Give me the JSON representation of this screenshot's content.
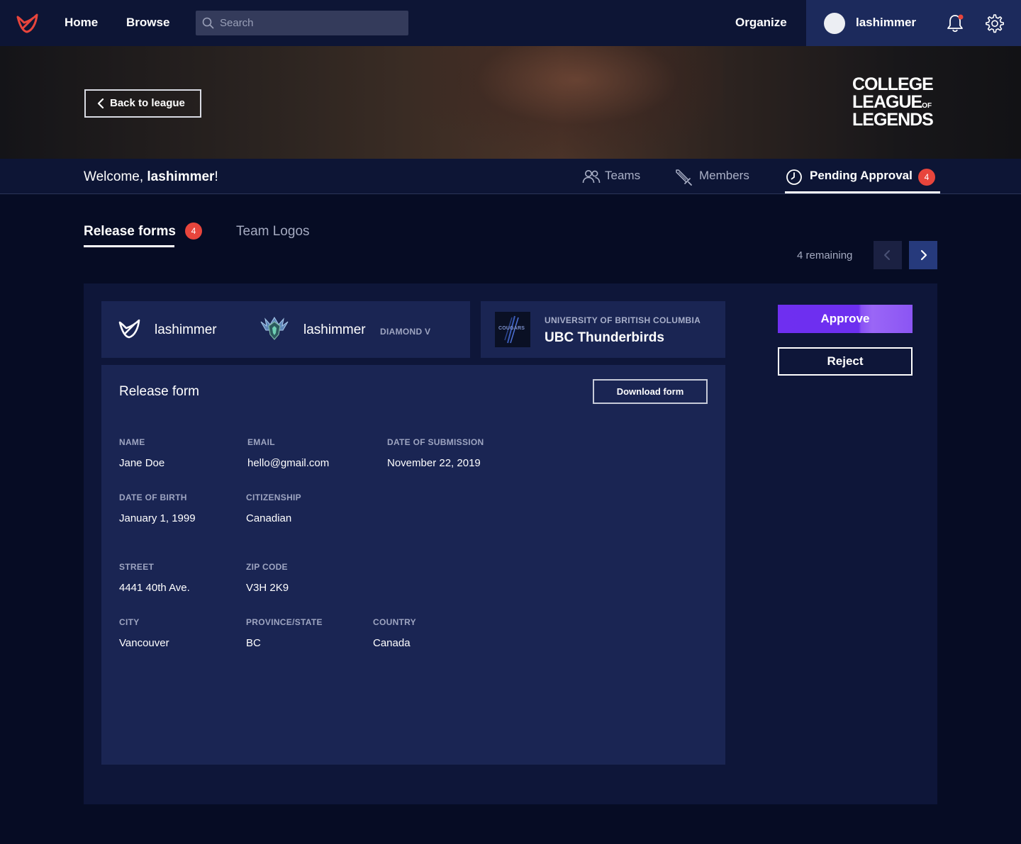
{
  "nav": {
    "home": "Home",
    "browse": "Browse",
    "search_placeholder": "Search",
    "organize": "Organize",
    "username": "lashimmer"
  },
  "banner": {
    "back_label": "Back to league",
    "logo_line1": "COLLEGE",
    "logo_line2": "LEAGUE",
    "logo_of": "OF",
    "logo_line3": "LEGENDS"
  },
  "subnav": {
    "welcome_prefix": "Welcome, ",
    "welcome_user": "lashimmer",
    "welcome_suffix": "!",
    "tabs": [
      {
        "label": "Teams",
        "icon": "users-icon"
      },
      {
        "label": "Members",
        "icon": "sword-icon"
      },
      {
        "label": "Pending Approval",
        "icon": "clock-icon",
        "badge": "4",
        "active": true
      }
    ]
  },
  "page_tabs": [
    {
      "label": "Release forms",
      "badge": "4",
      "active": true
    },
    {
      "label": "Team Logos",
      "active": false
    }
  ],
  "pager": {
    "remaining": "4 remaining"
  },
  "player": {
    "account_name": "lashimmer",
    "summoner_name": "lashimmer",
    "rank": "DIAMOND V"
  },
  "team": {
    "university": "UNIVERSITY OF BRITISH COLUMBIA",
    "name": "UBC Thunderbirds",
    "logo_text": "COUGARS"
  },
  "actions": {
    "approve": "Approve",
    "reject": "Reject"
  },
  "form": {
    "title": "Release form",
    "download": "Download form",
    "fields": {
      "name": {
        "label": "NAME",
        "value": "Jane Doe"
      },
      "email": {
        "label": "EMAIL",
        "value": "hello@gmail.com"
      },
      "submission": {
        "label": "DATE OF SUBMISSION",
        "value": "November 22, 2019"
      },
      "dob": {
        "label": "DATE OF BIRTH",
        "value": "January 1, 1999"
      },
      "citizenship": {
        "label": "CITIZENSHIP",
        "value": "Canadian"
      },
      "street": {
        "label": "STREET",
        "value": "4441 40th Ave."
      },
      "zip": {
        "label": "ZIP CODE",
        "value": "V3H 2K9"
      },
      "city": {
        "label": "CITY",
        "value": "Vancouver"
      },
      "province": {
        "label": "PROVINCE/STATE",
        "value": "BC"
      },
      "country": {
        "label": "COUNTRY",
        "value": "Canada"
      }
    }
  },
  "colors": {
    "background": "#060c24",
    "nav": "#0d1535",
    "card": "#1a2553",
    "accent_purple": "#6f2ff0",
    "badge_red": "#e8453c"
  }
}
